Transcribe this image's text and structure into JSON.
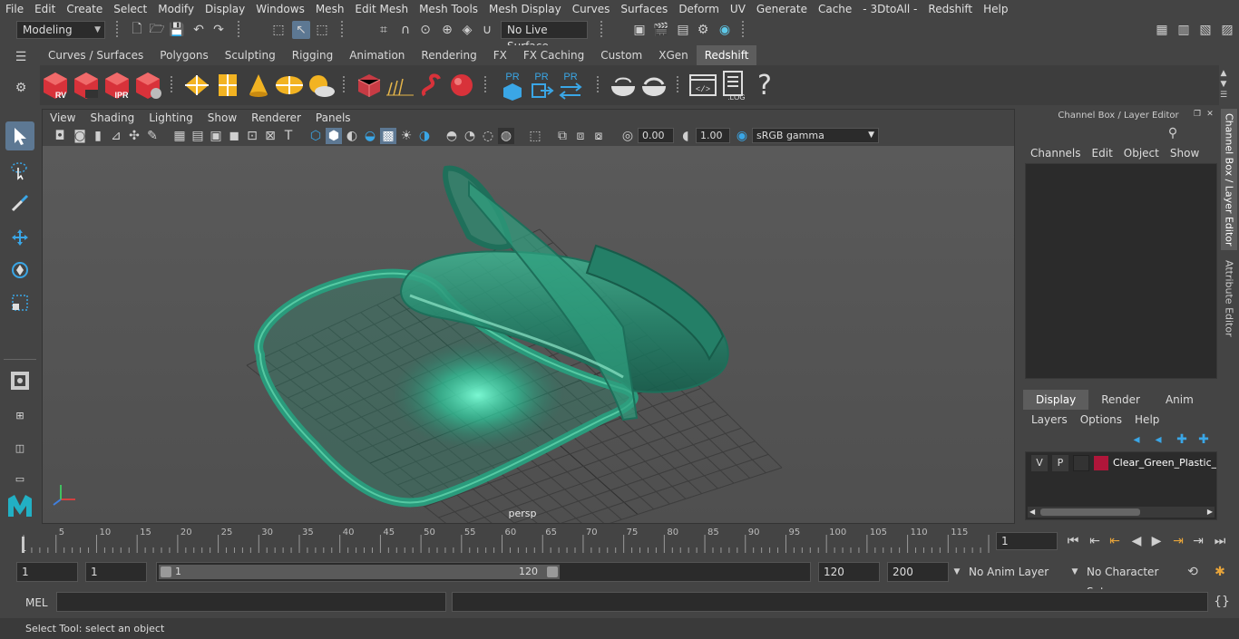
{
  "menubar": {
    "items": [
      "File",
      "Edit",
      "Create",
      "Select",
      "Modify",
      "Display",
      "Windows",
      "Mesh",
      "Edit Mesh",
      "Mesh Tools",
      "Mesh Display",
      "Curves",
      "Surfaces",
      "Deform",
      "UV",
      "Generate",
      "Cache",
      "- 3DtoAll -",
      "Redshift",
      "Help"
    ]
  },
  "statusline": {
    "mode": "Modeling",
    "live_surface": "No Live Surface"
  },
  "shelf": {
    "tabs": [
      "Curves / Surfaces",
      "Polygons",
      "Sculpting",
      "Rigging",
      "Animation",
      "Rendering",
      "FX",
      "FX Caching",
      "Custom",
      "XGen",
      "Redshift"
    ],
    "active_tab": "Redshift",
    "labels": {
      "rv": "RV",
      "ipr": "IPR",
      "pr1": "PR",
      "pr2": "PR",
      "pr3": "PR",
      "log": ".LOG",
      "help": "?"
    }
  },
  "viewport": {
    "menu": [
      "View",
      "Shading",
      "Lighting",
      "Show",
      "Renderer",
      "Panels"
    ],
    "exposure": "0.00",
    "gamma": "1.00",
    "color_space": "sRGB gamma",
    "camera": "persp"
  },
  "channelbox": {
    "title": "Channel Box / Layer Editor",
    "menu": [
      "Channels",
      "Edit",
      "Object",
      "Show"
    ],
    "layer_tabs": [
      "Display",
      "Render",
      "Anim"
    ],
    "layer_menu": [
      "Layers",
      "Options",
      "Help"
    ],
    "layer": {
      "v": "V",
      "p": "P",
      "name": "Clear_Green_Plastic_De",
      "color": "#b0163a"
    }
  },
  "side_tabs": [
    "Channel Box / Layer Editor",
    "Attribute Editor"
  ],
  "timeline": {
    "ticks": [
      "5",
      "10",
      "15",
      "20",
      "25",
      "30",
      "35",
      "40",
      "45",
      "50",
      "55",
      "60",
      "65",
      "70",
      "75",
      "80",
      "85",
      "90",
      "95",
      "100",
      "105",
      "110",
      "115",
      "12"
    ],
    "start_tick": "1",
    "current_frame": "1"
  },
  "range": {
    "start": "1",
    "playback_start": "1",
    "slider_start": "1",
    "slider_end": "120",
    "playback_end": "120",
    "end": "200",
    "anim_layer": "No Anim Layer",
    "character_set": "No Character Set"
  },
  "cmdline": {
    "language": "MEL"
  },
  "helpline": {
    "text": "Select Tool: select an object"
  },
  "colors": {
    "accent": "#5d7893",
    "object": "#1f8f72"
  }
}
